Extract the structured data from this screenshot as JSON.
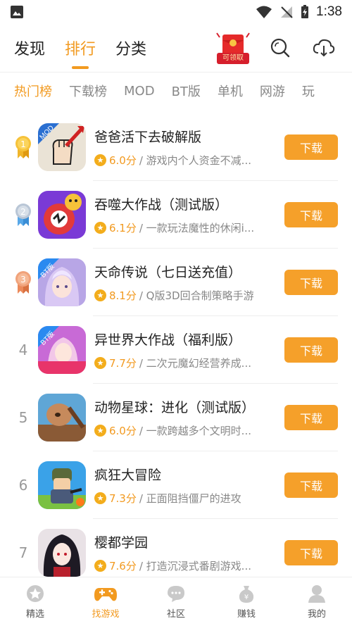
{
  "status_bar": {
    "time": "1:38"
  },
  "header": {
    "tabs": [
      {
        "label": "发现",
        "active": false
      },
      {
        "label": "排行",
        "active": true
      },
      {
        "label": "分类",
        "active": false
      }
    ],
    "gift_label": "可领取"
  },
  "category_tabs": [
    {
      "label": "热门榜",
      "active": true
    },
    {
      "label": "下载榜",
      "active": false
    },
    {
      "label": "MOD",
      "active": false
    },
    {
      "label": "BT版",
      "active": false
    },
    {
      "label": "单机",
      "active": false
    },
    {
      "label": "网游",
      "active": false
    },
    {
      "label": "玩",
      "active": false
    }
  ],
  "games": [
    {
      "rank": "1",
      "title": "爸爸活下去破解版",
      "score": "6.0分",
      "desc": "/ 游戏内个人资金不减...",
      "button": "下载",
      "tag": "MOD"
    },
    {
      "rank": "2",
      "title": "吞噬大作战（测试版）",
      "score": "6.1分",
      "desc": "/ 一款玩法魔性的休闲i...",
      "button": "下载",
      "tag": ""
    },
    {
      "rank": "3",
      "title": "天命传说（七日送充值）",
      "score": "8.1分",
      "desc": "/ Q版3D回合制策略手游",
      "button": "下载",
      "tag": "BT版"
    },
    {
      "rank": "4",
      "title": "异世界大作战（福利版）",
      "score": "7.7分",
      "desc": "/ 二次元魔幻经营养成...",
      "button": "下载",
      "tag": "BT版"
    },
    {
      "rank": "5",
      "title": "动物星球：进化（测试版）",
      "score": "6.0分",
      "desc": "/ 一款跨越多个文明时...",
      "button": "下载",
      "tag": ""
    },
    {
      "rank": "6",
      "title": "疯狂大冒险",
      "score": "7.3分",
      "desc": "/ 正面阻挡僵尸的进攻",
      "button": "下载",
      "tag": ""
    },
    {
      "rank": "7",
      "title": "樱都学园",
      "score": "7.6分",
      "desc": "/ 打造沉浸式番剧游戏...",
      "button": "下载",
      "tag": ""
    }
  ],
  "bottom_nav": [
    {
      "label": "精选",
      "icon": "star-badge-icon",
      "active": false
    },
    {
      "label": "找游戏",
      "icon": "gamepad-icon",
      "active": true
    },
    {
      "label": "社区",
      "icon": "chat-bubble-icon",
      "active": false
    },
    {
      "label": "赚钱",
      "icon": "money-bag-icon",
      "active": false
    },
    {
      "label": "我的",
      "icon": "profile-icon",
      "active": false
    }
  ],
  "colors": {
    "accent": "#f29a20",
    "button": "#f5a02a"
  }
}
